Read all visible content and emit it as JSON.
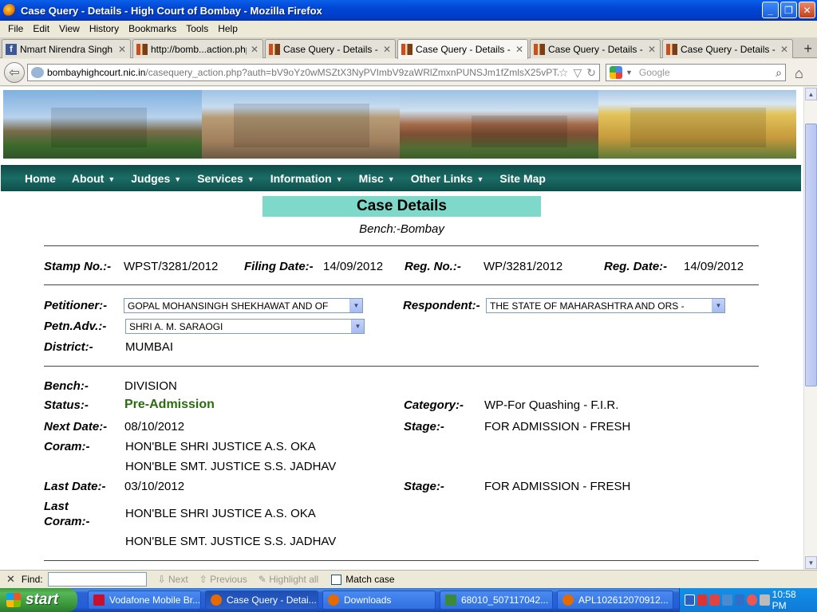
{
  "window": {
    "title": "Case Query - Details - High Court of Bombay - Mozilla Firefox",
    "buttons": {
      "minimize": "_",
      "maximize": "❐",
      "close": "✕"
    }
  },
  "menubar": [
    "File",
    "Edit",
    "View",
    "History",
    "Bookmarks",
    "Tools",
    "Help"
  ],
  "tabs": [
    {
      "label": "Nmart Nirendra Singh Di...",
      "icon": "facebook-icon"
    },
    {
      "label": "http://bomb...action.php",
      "icon": "highcourt-icon"
    },
    {
      "label": "Case Query - Details - ...",
      "icon": "highcourt-icon"
    },
    {
      "label": "Case Query - Details - ...",
      "icon": "highcourt-icon",
      "active": true
    },
    {
      "label": "Case Query - Details - ...",
      "icon": "highcourt-icon"
    },
    {
      "label": "Case Query - Details - ...",
      "icon": "highcourt-icon"
    }
  ],
  "nav": {
    "url_host": "bombayhighcourt.nic.in",
    "url_path": "/casequery_action.php?auth=bV9oYz0wMSZtX3NyPVImbV9zaWRlZmxnPUNSJm1fZmlsX25vPTAxMzA4MDMy",
    "search_placeholder": "Google"
  },
  "site": {
    "menu": [
      {
        "label": "Home",
        "dropdown": false
      },
      {
        "label": "About",
        "dropdown": true
      },
      {
        "label": "Judges",
        "dropdown": true
      },
      {
        "label": "Services",
        "dropdown": true
      },
      {
        "label": "Information",
        "dropdown": true
      },
      {
        "label": "Misc",
        "dropdown": true
      },
      {
        "label": "Other Links",
        "dropdown": true
      },
      {
        "label": "Site Map",
        "dropdown": false
      }
    ],
    "page_title": "Case Details",
    "bench_line": "Bench:-Bombay"
  },
  "case": {
    "stamp_label": "Stamp No.:-",
    "stamp_value": "WPST/3281/2012",
    "filing_label": "Filing Date:-",
    "filing_value": "14/09/2012",
    "regno_label": "Reg. No.:-",
    "regno_value": "WP/3281/2012",
    "regdate_label": "Reg. Date:-",
    "regdate_value": "14/09/2012",
    "petitioner_label": "Petitioner:-",
    "petitioner_value": "GOPAL MOHANSINGH SHEKHAWAT AND OF",
    "respondent_label": "Respondent:-",
    "respondent_value": "THE STATE OF MAHARASHTRA AND ORS -",
    "petnadv_label": "Petn.Adv.:-",
    "petnadv_value": "SHRI A. M. SARAOGI",
    "district_label": "District:-",
    "district_value": "MUMBAI",
    "bench_label": "Bench:-",
    "bench_value": "DIVISION",
    "status_label": "Status:-",
    "status_value": "Pre-Admission",
    "category_label": "Category:-",
    "category_value": "WP-For Quashing - F.I.R.",
    "nextdate_label": "Next Date:-",
    "nextdate_value": "08/10/2012",
    "stage_label": "Stage:-",
    "stage_value": "FOR ADMISSION - FRESH",
    "coram_label": "Coram:-",
    "coram_1": "HON'BLE SHRI JUSTICE A.S. OKA",
    "coram_2": "HON'BLE SMT. JUSTICE S.S. JADHAV",
    "lastdate_label": "Last Date:-",
    "lastdate_value": "03/10/2012",
    "laststage_label": "Stage:-",
    "laststage_value": "FOR ADMISSION - FRESH",
    "lastcoram_label_1": "Last",
    "lastcoram_label_2": "Coram:-",
    "lastcoram_1": "HON'BLE SHRI JUSTICE A.S. OKA",
    "lastcoram_2": "HON'BLE SMT. JUSTICE S.S. JADHAV"
  },
  "findbar": {
    "close": "✕",
    "label": "Find:",
    "next": "Next",
    "previous": "Previous",
    "highlight": "Highlight all",
    "match_case": "Match case"
  },
  "taskbar": {
    "start": "start",
    "tasks": [
      {
        "label": "Vodafone Mobile Br...",
        "icon_color": "#c8102e"
      },
      {
        "label": "Case Query - Detai...",
        "icon_color": "#e66a00",
        "active": true
      },
      {
        "label": "Downloads",
        "icon_color": "#e66a00"
      },
      {
        "label": "68010_507117042...",
        "icon_color": "#3a8a3a"
      },
      {
        "label": "APL102612070912...",
        "icon_color": "#e66a00"
      }
    ],
    "clock": "10:58 PM"
  },
  "colors": {
    "site_menu": "#1b6c66",
    "title_box": "#7fd9cb",
    "status_green": "#2b6c12"
  }
}
